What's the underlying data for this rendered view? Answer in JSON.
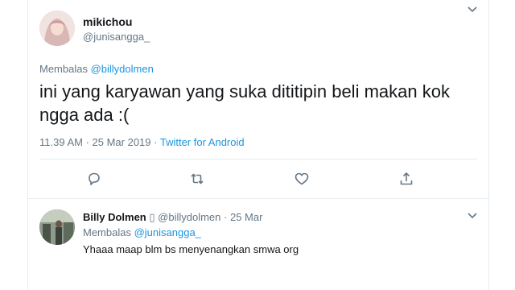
{
  "main_tweet": {
    "display_name": "mikichou",
    "handle": "@junisangga_",
    "reply_prefix": "Membalas",
    "reply_to": "@billydolmen",
    "text": "ini yang karyawan yang suka dititipin beli makan kok ngga ada :(",
    "timestamp": "11.39 AM · 25 Mar 2019 ·",
    "source": "Twitter for Android",
    "actions": [
      "reply-icon",
      "retweet-icon",
      "like-icon",
      "share-icon"
    ]
  },
  "reply_tweet": {
    "display_name": "Billy Dolmen",
    "badge_glyph": "▯",
    "handle": "@billydolmen",
    "separator": "·",
    "date": "25 Mar",
    "reply_prefix": "Membalas",
    "reply_to": "@junisangga_",
    "text": "Yhaaa maap blm bs menyenangkan smwa org"
  },
  "colors": {
    "link": "#1b95e0",
    "muted": "#657786",
    "text": "#14171a",
    "border": "#e6ecf0"
  }
}
